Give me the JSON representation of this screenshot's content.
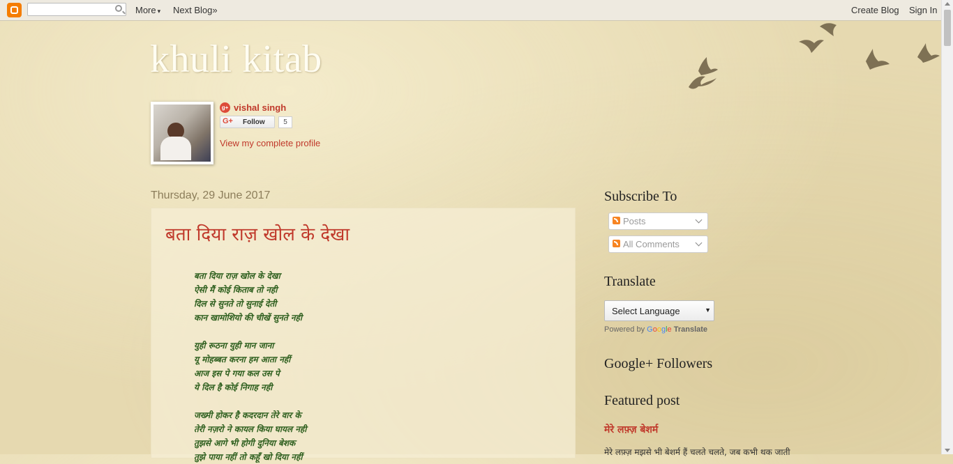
{
  "navbar": {
    "search_placeholder": "",
    "more_label": "More",
    "more_caret": "▾",
    "next_blog_label": "Next Blog»",
    "create_blog_label": "Create Blog",
    "sign_in_label": "Sign In"
  },
  "header": {
    "blog_title": "khuli kitab"
  },
  "profile": {
    "name": "vishal singh",
    "follow_label": "Follow",
    "follower_count": "5",
    "profile_link": "View my complete profile"
  },
  "post": {
    "date": "Thursday, 29 June 2017",
    "title": "बता दिया राज़ खोल के देखा",
    "stanzas": [
      [
        "बता दिया राज़ खोल के देखा",
        "ऐसी मैं कोई किताब तो नही",
        "दिल  से  सुनते  तो  सुनाई  देती",
        "कान खामोशियो की चीखें सुनते नही"
      ],
      [
        "युही रूठना युही मान जाना",
        "यू मोहब्बत करना हम आता नहीं",
        "आज इस पे गया कल उस पे",
        "ये दिल है कोई निगाह नही"
      ],
      [
        "जख्मी होकर है कदरदान तेरे वार के",
        "तेरी नज़रो ने कायल किया घायल नही",
        "तुझसे आगे भी होगी दुनिया बेशक",
        "तुझे पाया नहीं तो कहूँ खो दिया नहीं"
      ]
    ]
  },
  "sidebar": {
    "subscribe_heading": "Subscribe To",
    "subscribe_posts": "Posts",
    "subscribe_comments": "All Comments",
    "translate_heading": "Translate",
    "select_language": "Select Language",
    "select_arrow": "▼",
    "powered_by": "Powered by",
    "google_g": "G",
    "google_o1": "o",
    "google_o2": "o",
    "google_g2": "g",
    "google_l": "l",
    "google_e": "e",
    "translate_link": "Translate",
    "followers_heading": "Google+ Followers",
    "featured_heading": "Featured post",
    "featured_title": "मेरे लफ़्ज़ बेशर्म",
    "featured_snippet": "मेरे लफ़्ज़ मझसे भी बेशर्म हैं चलते चलते, जब कभी थक जाती"
  },
  "icons": {
    "blogger_logo": "blogger-icon",
    "search": "search-icon",
    "gplus": "gplus-icon",
    "feed": "feed-icon",
    "birds": "birds-decoration"
  },
  "colors": {
    "link_red": "#c0392b",
    "poem_green": "#2e5f1e",
    "background": "#e6d9b0"
  }
}
